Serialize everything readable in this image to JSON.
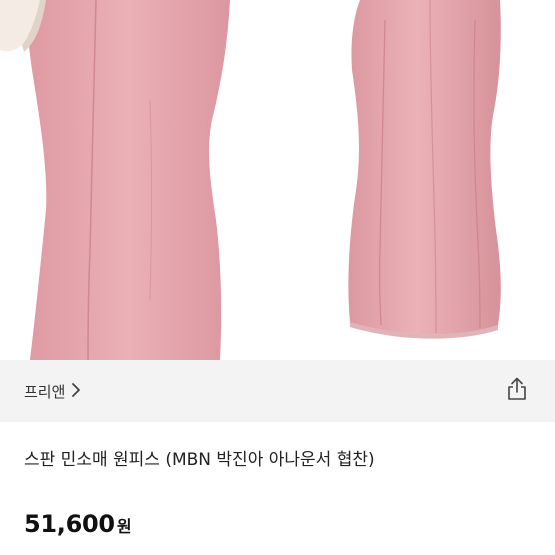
{
  "product_image": {
    "icon": "pink-sleeveless-dress-photo",
    "colors": {
      "dress": "#e9a7ae",
      "dress_shade": "#d68f97",
      "collar": "#f5ece6"
    }
  },
  "shop": {
    "name": "프리앤",
    "chevron_icon": "chevron-right-icon",
    "share_icon": "share-icon"
  },
  "product": {
    "title": "스판 민소매 원피스 (MBN 박진아 아나운서 협찬)",
    "price": "51,600",
    "currency": "원"
  }
}
